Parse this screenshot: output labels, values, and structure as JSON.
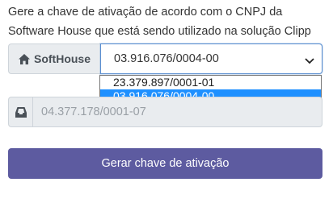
{
  "intro": {
    "line1": "Gere a chave de ativação de acordo com o CNPJ da",
    "line2": "Software House que está sendo utilizado na solução Clipp"
  },
  "softhouse": {
    "label": "SoftHouse",
    "icon": "home-icon",
    "selected_value": "03.916.076/0004-00",
    "options": [
      "23.379.897/0001-01",
      "03.916.076/0004-00"
    ],
    "highlighted_option": "03.916.076/0004-00"
  },
  "cnpj_field": {
    "icon": "inbox-icon",
    "value": "04.377.178/0001-07"
  },
  "generate_button": {
    "label": "Gerar chave de ativação",
    "color": "#5d5ba0"
  }
}
